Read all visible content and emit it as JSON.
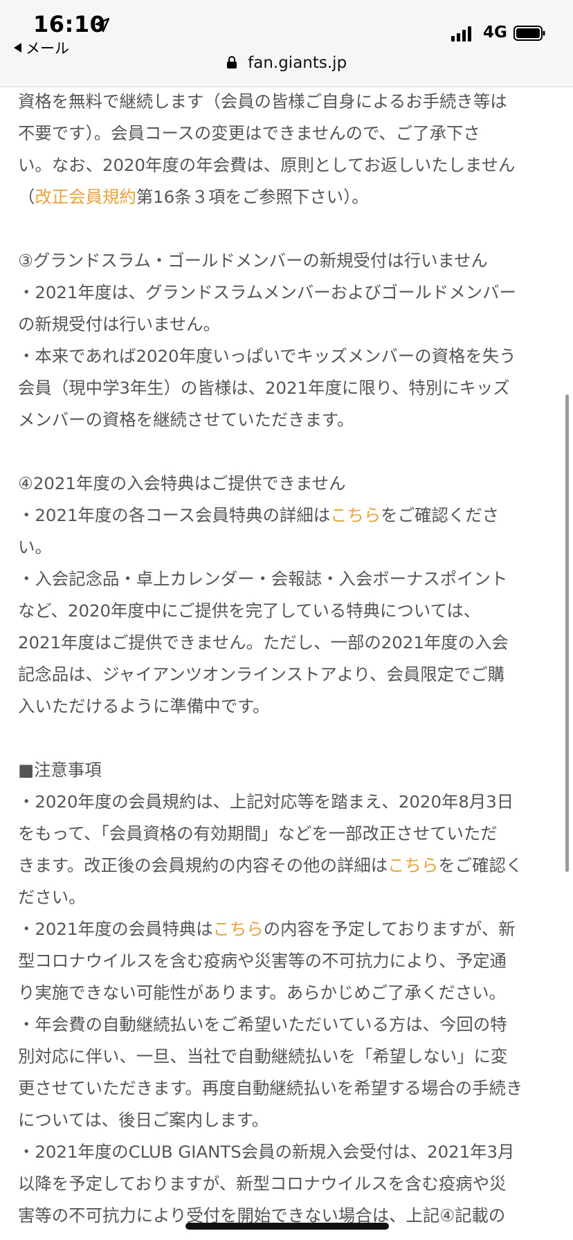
{
  "status_bar": {
    "time": "16:10",
    "back_label": "メール",
    "network": "4G"
  },
  "browser": {
    "url": "fan.giants.jp"
  },
  "content": {
    "lines": [
      {
        "segments": [
          {
            "text": "資格を無料で継続します（会員の皆様ご自身によるお手続き等は"
          }
        ]
      },
      {
        "segments": [
          {
            "text": "不要です）。会員コースの変更はできませんので、ご了承下さ"
          }
        ]
      },
      {
        "segments": [
          {
            "text": "い。なお、2020年度の年会費は、原則としてお返しいたしません"
          }
        ]
      },
      {
        "segments": [
          {
            "text": "（"
          },
          {
            "text": "改正会員規約",
            "link": true
          },
          {
            "text": "第16条３項をご参照下さい）。"
          }
        ]
      },
      {
        "blank": true
      },
      {
        "segments": [
          {
            "text": "③グランドスラム・ゴールドメンバーの新規受付は行いません"
          }
        ]
      },
      {
        "segments": [
          {
            "text": "・2021年度は、グランドスラムメンバーおよびゴールドメンバー"
          }
        ]
      },
      {
        "segments": [
          {
            "text": "の新規受付は行いません。"
          }
        ]
      },
      {
        "segments": [
          {
            "text": "・本来であれば2020年度いっぱいでキッズメンバーの資格を失う"
          }
        ]
      },
      {
        "segments": [
          {
            "text": "会員（現中学3年生）の皆様は、2021年度に限り、特別にキッズ"
          }
        ]
      },
      {
        "segments": [
          {
            "text": "メンバーの資格を継続させていただきます。"
          }
        ]
      },
      {
        "blank": true
      },
      {
        "segments": [
          {
            "text": "④2021年度の入会特典はご提供できません"
          }
        ]
      },
      {
        "segments": [
          {
            "text": "・2021年度の各コース会員特典の詳細は"
          },
          {
            "text": "こちら",
            "link": true
          },
          {
            "text": "をご確認くださ"
          }
        ]
      },
      {
        "segments": [
          {
            "text": "い。"
          }
        ]
      },
      {
        "segments": [
          {
            "text": "・入会記念品・卓上カレンダー・会報誌・入会ボーナスポイント"
          }
        ]
      },
      {
        "segments": [
          {
            "text": "など、2020年度中にご提供を完了している特典については、"
          }
        ]
      },
      {
        "segments": [
          {
            "text": "2021年度はご提供できません。ただし、一部の2021年度の入会"
          }
        ]
      },
      {
        "segments": [
          {
            "text": "記念品は、ジャイアンツオンラインストアより、会員限定でご購"
          }
        ]
      },
      {
        "segments": [
          {
            "text": "入いただけるように準備中です。"
          }
        ]
      },
      {
        "blank": true
      },
      {
        "segments": [
          {
            "text": "■注意事項"
          }
        ]
      },
      {
        "segments": [
          {
            "text": "・2020年度の会員規約は、上記対応等を踏まえ、2020年8月3日"
          }
        ]
      },
      {
        "segments": [
          {
            "text": "をもって、「会員資格の有効期間」などを一部改正させていただ"
          }
        ]
      },
      {
        "segments": [
          {
            "text": "きます。改正後の会員規約の内容その他の詳細は"
          },
          {
            "text": "こちら",
            "link": true
          },
          {
            "text": "をご確認く"
          }
        ]
      },
      {
        "segments": [
          {
            "text": "ださい。"
          }
        ]
      },
      {
        "segments": [
          {
            "text": "・2021年度の会員特典は"
          },
          {
            "text": "こちら",
            "link": true
          },
          {
            "text": "の内容を予定しておりますが、新"
          }
        ]
      },
      {
        "segments": [
          {
            "text": "型コロナウイルスを含む疫病や災害等の不可抗力により、予定通"
          }
        ]
      },
      {
        "segments": [
          {
            "text": "り実施できない可能性があります。あらかじめご了承ください。"
          }
        ]
      },
      {
        "segments": [
          {
            "text": "・年会費の自動継続払いをご希望いただいている方は、今回の特"
          }
        ]
      },
      {
        "segments": [
          {
            "text": "別対応に伴い、一旦、当社で自動継続払いを「希望しない」に変"
          }
        ]
      },
      {
        "segments": [
          {
            "text": "更させていただきます。再度自動継続払いを希望する場合の手続き"
          }
        ]
      },
      {
        "segments": [
          {
            "text": "については、後日ご案内します。"
          }
        ]
      },
      {
        "segments": [
          {
            "text": "・2021年度のCLUB GIANTS会員の新規入会受付は、2021年3月"
          }
        ]
      },
      {
        "segments": [
          {
            "text": "以降を予定しておりますが、新型コロナウイルスを含む疫病や災"
          }
        ]
      },
      {
        "segments": [
          {
            "text": "害等の不可抗力により受付を開始できない場合は、上記④記載の"
          }
        ]
      }
    ]
  },
  "colors": {
    "link": "#e8a33a",
    "body_text": "#555555"
  },
  "icons": [
    "location-arrow-icon",
    "back-triangle-icon",
    "signal-bars-icon",
    "battery-icon",
    "lock-icon"
  ]
}
